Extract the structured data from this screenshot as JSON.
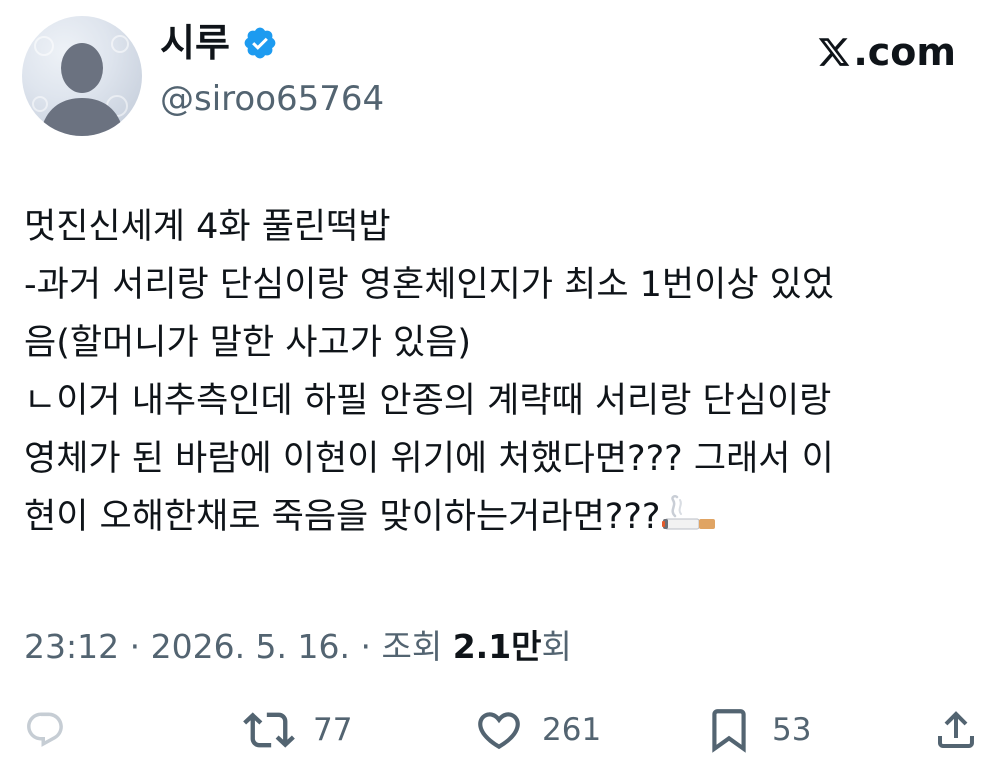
{
  "author": {
    "display_name": "시루",
    "handle": "@siroo65764",
    "verified": true
  },
  "brand": {
    "label": ".com",
    "icon": "x-logo-icon"
  },
  "tweet": {
    "lines": [
      "멋진신세계 4화 풀린떡밥",
      "-과거 서리랑 단심이랑 영혼체인지가 최소 1번이상 있었",
      "음(할머니가 말한 사고가 있음)",
      "ㄴ이거 내추측인데 하필 안종의 계략때 서리랑 단심이랑",
      "영체가 된 바람에 이현이 위기에 처했다면??? 그래서 이",
      "현이 오해한채로 죽음을 맞이하는거라면???"
    ],
    "trailing_emoji": "cigarette-emoji-icon"
  },
  "meta": {
    "time": "23:12",
    "separator": " · ",
    "date": "2026. 5. 16.",
    "views_prefix": "조회 ",
    "views_number": "2.1만",
    "views_suffix": "회"
  },
  "actions": {
    "reply": {
      "icon": "reply-icon",
      "count": ""
    },
    "repost": {
      "icon": "repost-icon",
      "count": "77"
    },
    "like": {
      "icon": "heart-icon",
      "count": "261"
    },
    "bookmark": {
      "icon": "bookmark-icon",
      "count": "53"
    },
    "share": {
      "icon": "share-icon",
      "count": ""
    }
  },
  "colors": {
    "text_primary": "#0f1419",
    "text_secondary": "#536471",
    "verified_blue": "#1d9bf0"
  }
}
